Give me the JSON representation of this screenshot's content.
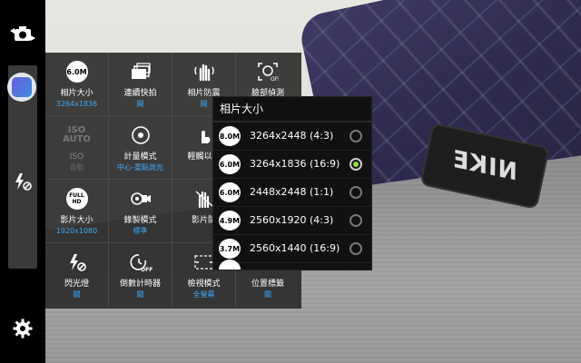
{
  "left_bar": {
    "switch_camera_icon": "camera-switch-icon",
    "mode_icon": "camera-mode-icon",
    "flash_icon": "flash-off-icon",
    "settings_icon": "gear-icon"
  },
  "settings_grid": [
    {
      "key": "photo_size",
      "icon": "6.0M",
      "label": "相片大小",
      "value": "3264x1836",
      "enabled": true
    },
    {
      "key": "burst",
      "icon": "burst-shot-icon",
      "label": "連續快拍",
      "value": "開",
      "enabled": true
    },
    {
      "key": "stabilize",
      "icon": "anti-shake-icon",
      "label": "相片防震",
      "value": "開",
      "enabled": true
    },
    {
      "key": "face_detect",
      "icon": "face-detection-icon",
      "label": "臉部偵測",
      "value": "",
      "enabled": true
    },
    {
      "key": "iso",
      "icon": "ISO AUTO",
      "label": "ISO",
      "value": "自動",
      "enabled": false
    },
    {
      "key": "metering",
      "icon": "metering-icon",
      "label": "計量模式",
      "value": "中心-重點測光",
      "enabled": true
    },
    {
      "key": "tap_shot",
      "icon": "tap-shot-icon",
      "label": "輕觸以拍",
      "value": "",
      "enabled": true
    },
    {
      "key": "empty1",
      "icon": "",
      "label": "",
      "value": "",
      "enabled": true
    },
    {
      "key": "video_size",
      "icon": "FULL HD",
      "label": "影片大小",
      "value": "1920x1080",
      "enabled": true
    },
    {
      "key": "record_mode",
      "icon": "video-record-icon",
      "label": "錄製模式",
      "value": "標準",
      "enabled": true
    },
    {
      "key": "video_stabilize",
      "icon": "video-stabilize-icon",
      "label": "影片防",
      "value": "",
      "enabled": true
    },
    {
      "key": "empty2",
      "icon": "",
      "label": "",
      "value": "",
      "enabled": true
    },
    {
      "key": "flash",
      "icon": "flash-off-icon",
      "label": "閃光燈",
      "value": "關",
      "enabled": true
    },
    {
      "key": "timer",
      "icon": "timer-off-icon",
      "label": "倒數計時器",
      "value": "關",
      "enabled": true
    },
    {
      "key": "view_mode",
      "icon": "view-mode-icon",
      "label": "檢視模式",
      "value": "全螢幕",
      "enabled": true
    },
    {
      "key": "location",
      "icon": "location-icon",
      "label": "位置標籤",
      "value": "關",
      "enabled": true
    }
  ],
  "popup": {
    "title": "相片大小",
    "options": [
      {
        "badge": "8.0M",
        "label": "3264x2448 (4:3)",
        "selected": false
      },
      {
        "badge": "6.0M",
        "label": "3264x1836 (16:9)",
        "selected": true
      },
      {
        "badge": "6.0M",
        "label": "2448x2448 (1:1)",
        "selected": false
      },
      {
        "badge": "4.9M",
        "label": "2560x1920 (4:3)",
        "selected": false
      },
      {
        "badge": "3.7M",
        "label": "2560x1440 (16:9)",
        "selected": false
      }
    ]
  },
  "viewfinder": {
    "tag_text": "NIKE"
  },
  "colors": {
    "accent_blue": "#3fa9f5",
    "radio_green": "#8fe23a"
  }
}
